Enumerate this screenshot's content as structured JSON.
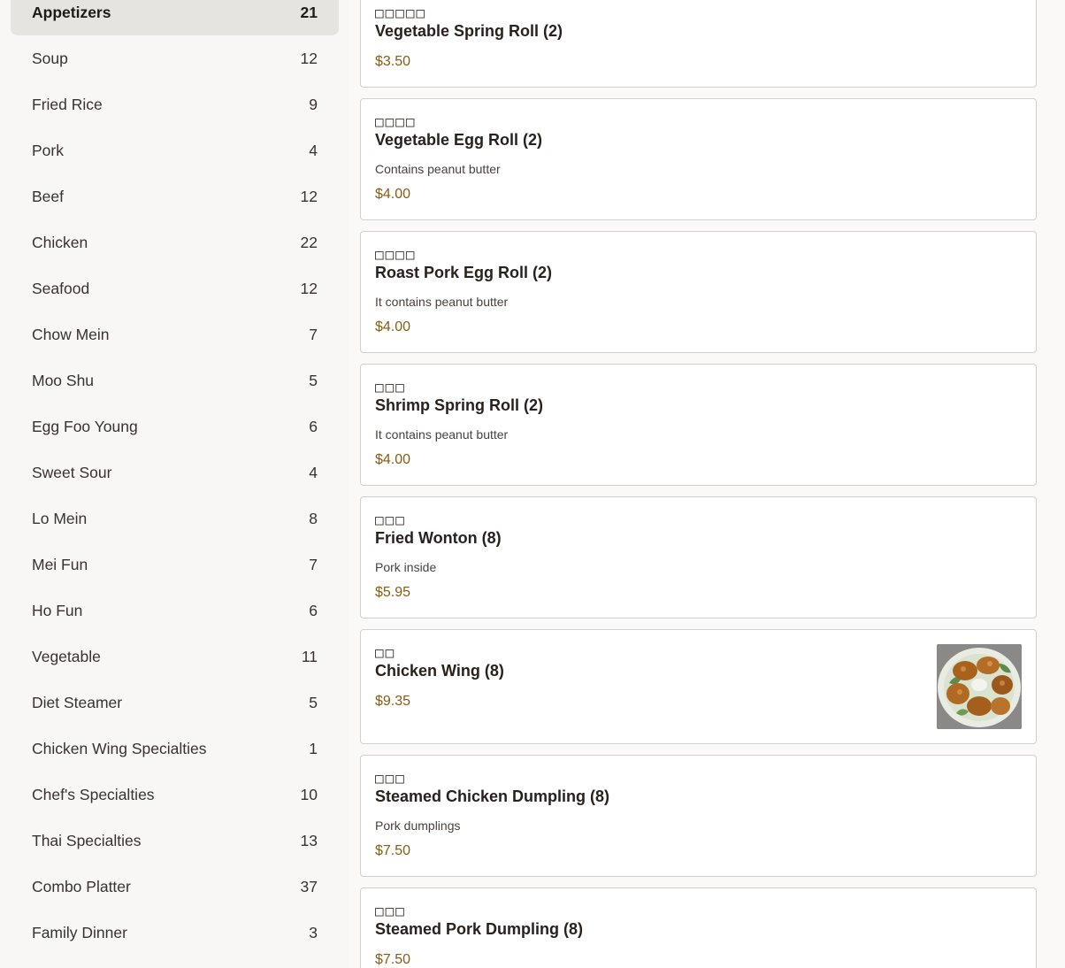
{
  "sidebar": {
    "categories": [
      {
        "label": "Appetizers",
        "count": "21"
      },
      {
        "label": "Soup",
        "count": "12"
      },
      {
        "label": "Fried Rice",
        "count": "9"
      },
      {
        "label": "Pork",
        "count": "4"
      },
      {
        "label": "Beef",
        "count": "12"
      },
      {
        "label": "Chicken",
        "count": "22"
      },
      {
        "label": "Seafood",
        "count": "12"
      },
      {
        "label": "Chow Mein",
        "count": "7"
      },
      {
        "label": "Moo Shu",
        "count": "5"
      },
      {
        "label": "Egg Foo Young",
        "count": "6"
      },
      {
        "label": "Sweet Sour",
        "count": "4"
      },
      {
        "label": "Lo Mein",
        "count": "8"
      },
      {
        "label": "Mei Fun",
        "count": "7"
      },
      {
        "label": "Ho Fun",
        "count": "6"
      },
      {
        "label": "Vegetable",
        "count": "11"
      },
      {
        "label": "Diet Steamer",
        "count": "5"
      },
      {
        "label": "Chicken Wing Specialties",
        "count": "1"
      },
      {
        "label": "Chef's Specialties",
        "count": "10"
      },
      {
        "label": "Thai Specialties",
        "count": "13"
      },
      {
        "label": "Combo Platter",
        "count": "37"
      },
      {
        "label": "Family Dinner",
        "count": "3"
      }
    ]
  },
  "items": [
    {
      "cn": "□□□□□",
      "name": "Vegetable Spring Roll (2)",
      "desc": "",
      "price": "$3.50"
    },
    {
      "cn": "□□□□",
      "name": "Vegetable Egg Roll (2)",
      "desc": "Contains peanut butter",
      "price": "$4.00"
    },
    {
      "cn": "□□□□",
      "name": "Roast Pork Egg Roll (2)",
      "desc": "It contains peanut butter",
      "price": "$4.00"
    },
    {
      "cn": "□□□",
      "name": "Shrimp Spring Roll (2)",
      "desc": "It contains peanut butter",
      "price": "$4.00"
    },
    {
      "cn": "□□□",
      "name": "Fried Wonton (8)",
      "desc": "Pork inside",
      "price": "$5.95"
    },
    {
      "cn": "□□",
      "name": "Chicken Wing (8)",
      "desc": "",
      "price": "$9.35"
    },
    {
      "cn": "□□□",
      "name": "Steamed Chicken Dumpling (8)",
      "desc": "Pork dumplings",
      "price": "$7.50"
    },
    {
      "cn": "□□□",
      "name": "Steamed Pork Dumpling (8)",
      "desc": "",
      "price": "$7.50"
    }
  ],
  "colors": {
    "price": "#8a5a12",
    "active_category_bg": "#e6e4e0",
    "card_border": "#d3d0cb"
  }
}
